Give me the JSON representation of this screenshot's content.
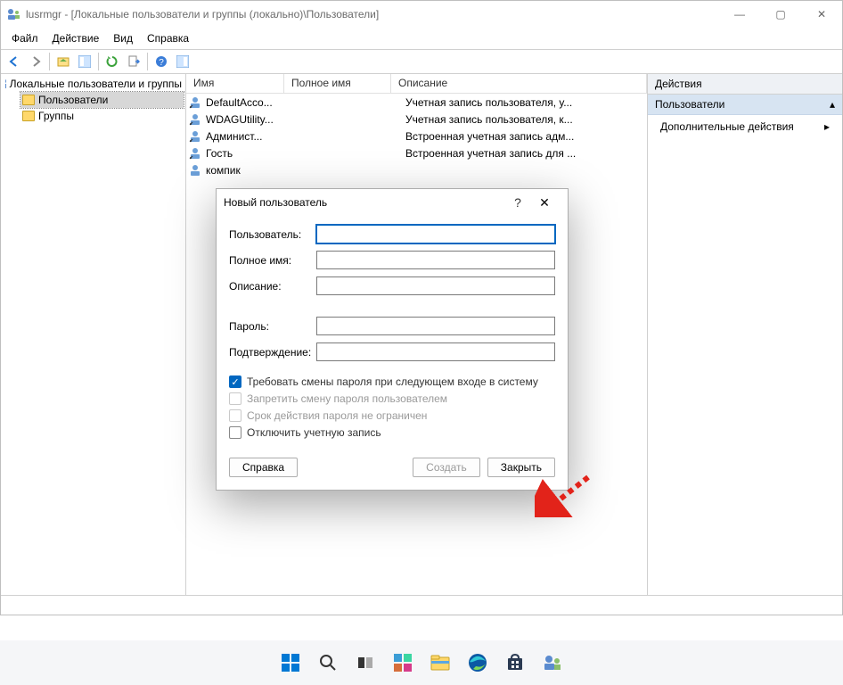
{
  "window": {
    "title": "lusrmgr - [Локальные пользователи и группы (локально)\\Пользователи]"
  },
  "menu": {
    "file": "Файл",
    "action": "Действие",
    "view": "Вид",
    "help": "Справка"
  },
  "tree": {
    "root": "Локальные пользователи и группы",
    "users": "Пользователи",
    "groups": "Группы"
  },
  "list": {
    "headers": {
      "name": "Имя",
      "fullname": "Полное имя",
      "desc": "Описание"
    },
    "rows": [
      {
        "name": "DefaultAcco...",
        "fullname": "",
        "desc": "Учетная запись пользователя, у..."
      },
      {
        "name": "WDAGUtility...",
        "fullname": "",
        "desc": "Учетная запись пользователя, к..."
      },
      {
        "name": "Админист...",
        "fullname": "",
        "desc": "Встроенная учетная запись адм..."
      },
      {
        "name": "Гость",
        "fullname": "",
        "desc": "Встроенная учетная запись для ..."
      },
      {
        "name": "компик",
        "fullname": "",
        "desc": ""
      }
    ]
  },
  "actions": {
    "head": "Действия",
    "context": "Пользователи",
    "more": "Дополнительные действия"
  },
  "dialog": {
    "title": "Новый пользователь",
    "user_label": "Пользователь:",
    "fullname_label": "Полное имя:",
    "desc_label": "Описание:",
    "password_label": "Пароль:",
    "confirm_label": "Подтверждение:",
    "chk_mustchange": "Требовать смены пароля при следующем входе в систему",
    "chk_cannotchange": "Запретить смену пароля пользователем",
    "chk_neverexpire": "Срок действия пароля не ограничен",
    "chk_disabled": "Отключить учетную запись",
    "btn_help": "Справка",
    "btn_create": "Создать",
    "btn_close": "Закрыть"
  }
}
